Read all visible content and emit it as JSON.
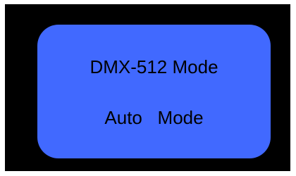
{
  "panel": {
    "color": "#4169FF",
    "line1": "DMX-512 Mode",
    "line2": "Auto   Mode"
  },
  "display": {
    "background": "#000000"
  }
}
